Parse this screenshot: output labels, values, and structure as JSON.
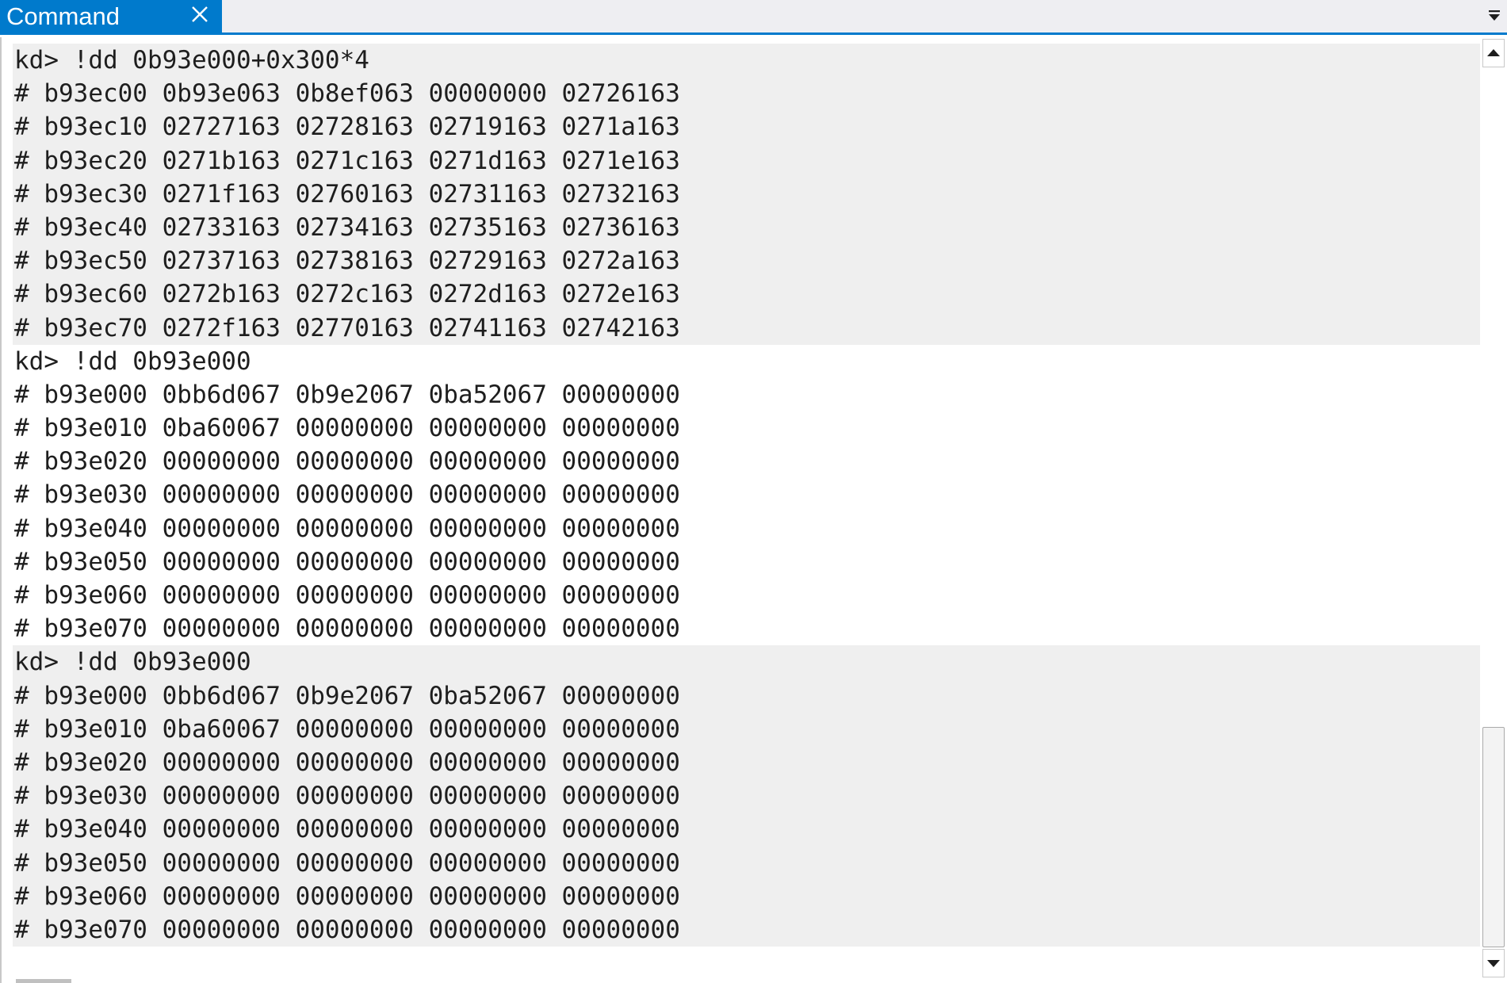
{
  "window": {
    "tab_title": "Command",
    "accent_color": "#007acc"
  },
  "icons": {
    "close": "close-icon",
    "dropdown": "chevron-down-icon",
    "scroll_up": "scroll-up-arrow-icon",
    "scroll_down": "scroll-down-arrow-icon"
  },
  "output": {
    "blocks": [
      {
        "lines": [
          "kd> !dd 0b93e000+0x300*4",
          "# b93ec00 0b93e063 0b8ef063 00000000 02726163",
          "# b93ec10 02727163 02728163 02719163 0271a163",
          "# b93ec20 0271b163 0271c163 0271d163 0271e163",
          "# b93ec30 0271f163 02760163 02731163 02732163",
          "# b93ec40 02733163 02734163 02735163 02736163",
          "# b93ec50 02737163 02738163 02729163 0272a163",
          "# b93ec60 0272b163 0272c163 0272d163 0272e163",
          "# b93ec70 0272f163 02770163 02741163 02742163"
        ]
      },
      {
        "lines": [
          "kd> !dd 0b93e000",
          "# b93e000 0bb6d067 0b9e2067 0ba52067 00000000",
          "# b93e010 0ba60067 00000000 00000000 00000000",
          "# b93e020 00000000 00000000 00000000 00000000",
          "# b93e030 00000000 00000000 00000000 00000000",
          "# b93e040 00000000 00000000 00000000 00000000",
          "# b93e050 00000000 00000000 00000000 00000000",
          "# b93e060 00000000 00000000 00000000 00000000",
          "# b93e070 00000000 00000000 00000000 00000000"
        ]
      },
      {
        "lines": [
          "kd> !dd 0b93e000",
          "# b93e000 0bb6d067 0b9e2067 0ba52067 00000000",
          "# b93e010 0ba60067 00000000 00000000 00000000",
          "# b93e020 00000000 00000000 00000000 00000000",
          "# b93e030 00000000 00000000 00000000 00000000",
          "# b93e040 00000000 00000000 00000000 00000000",
          "# b93e050 00000000 00000000 00000000 00000000",
          "# b93e060 00000000 00000000 00000000 00000000",
          "# b93e070 00000000 00000000 00000000 00000000"
        ]
      }
    ]
  }
}
